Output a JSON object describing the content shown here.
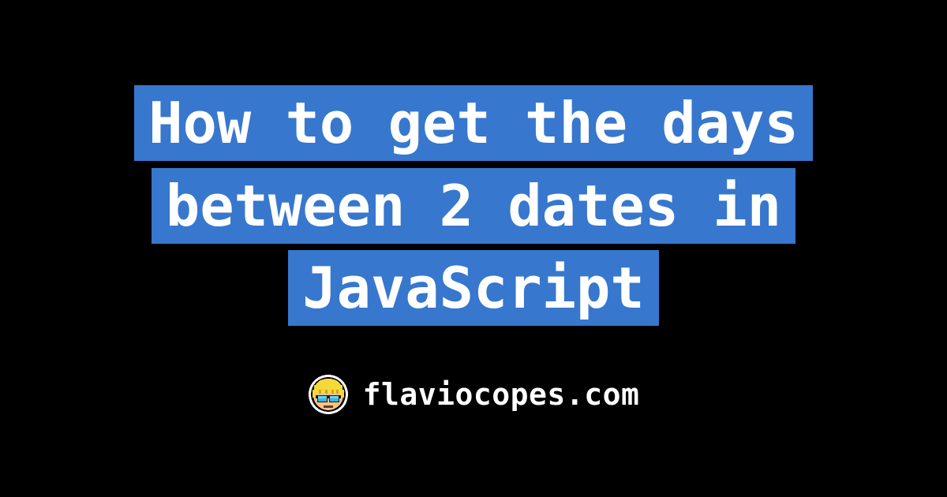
{
  "title": {
    "text": "How to get the days between 2 dates in JavaScript",
    "highlight_color": "#3777CE",
    "text_color": "#ffffff"
  },
  "footer": {
    "site_label": "flaviocopes.com",
    "avatar_name": "avatar-icon"
  },
  "background": "#000000"
}
